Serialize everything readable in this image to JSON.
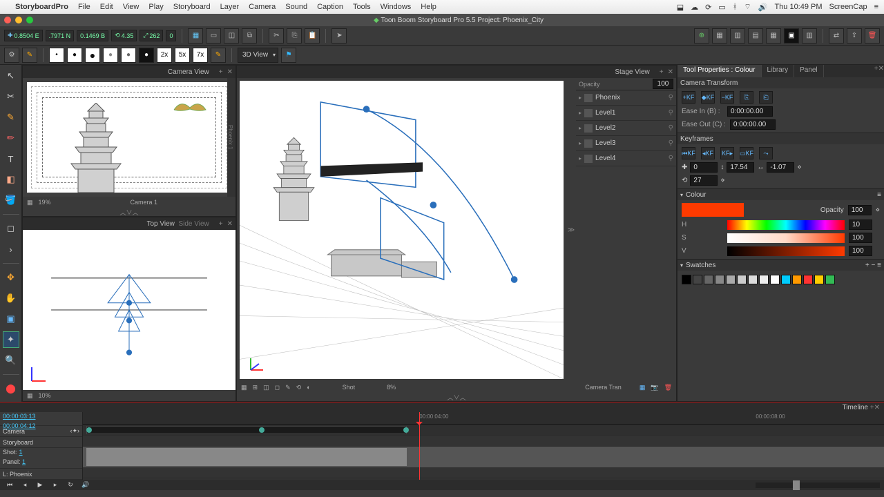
{
  "menubar": {
    "items": [
      "StoryboardPro",
      "File",
      "Edit",
      "View",
      "Play",
      "Storyboard",
      "Layer",
      "Camera",
      "Sound",
      "Caption",
      "Tools",
      "Windows",
      "Help"
    ],
    "clock": "Thu 10:49 PM",
    "capture": "ScreenCap"
  },
  "window": {
    "title": "Toon Boom Storyboard Pro 5.5 Project: Phoenix_City"
  },
  "readouts": {
    "x": "0.8504 E",
    "y": ".7971 N",
    "z": "0.1469 B",
    "a": "4.35",
    "b": "262",
    "c": "0"
  },
  "viewDrop": "3D View",
  "panels": {
    "camera": {
      "title": "Camera View",
      "zoom": "19%",
      "label": "Camera 1"
    },
    "topview": {
      "tabs": [
        "Top View",
        "Side View"
      ],
      "zoom": "10%"
    },
    "stage": {
      "title": "Stage View",
      "shot": "Shot",
      "pct": "8%",
      "right": "Camera Tran"
    },
    "opacity": {
      "label": "Opacity",
      "value": "100"
    }
  },
  "layers": [
    {
      "name": "Phoenix"
    },
    {
      "name": "Level1"
    },
    {
      "name": "Level2"
    },
    {
      "name": "Level3"
    },
    {
      "name": "Level4"
    }
  ],
  "right": {
    "tabs": [
      "Tool Properties : Colour",
      "Library",
      "Panel"
    ],
    "cameraTransform": "Camera Transform",
    "easeInLabel": "Ease In (B) :",
    "easeInVal": "0:00:00.00",
    "easeOutLabel": "Ease Out (C) :",
    "easeOutVal": "0:00:00.00",
    "keyframes": "Keyframes",
    "coords": {
      "x": "0",
      "y": "17.54",
      "z": "-1.07",
      "r": "27"
    },
    "colour": "Colour",
    "opacityLabel": "Opacity",
    "opacityVal": "100",
    "h": "10",
    "s": "100",
    "v": "100",
    "swatches": "Swatches",
    "swatchColors": [
      "#000",
      "#444",
      "#666",
      "#888",
      "#aaa",
      "#ccc",
      "#ddd",
      "#eee",
      "#fff",
      "#0cf",
      "#f90",
      "#f33",
      "#fc0",
      "#3b5"
    ]
  },
  "timeline": {
    "title": "Timeline",
    "tc1": "00:00:03:13",
    "tc2": "00:00:04:12",
    "cameraLabel": "Camera",
    "storyboardLabel": "Storyboard",
    "shotLabel": "Shot:",
    "shotVal": "1",
    "panelLabel": "Panel:",
    "panelVal": "1",
    "layerLabel": "L: Phoenix",
    "marks": [
      "00:00:04:00",
      "00:00:08:00"
    ]
  }
}
